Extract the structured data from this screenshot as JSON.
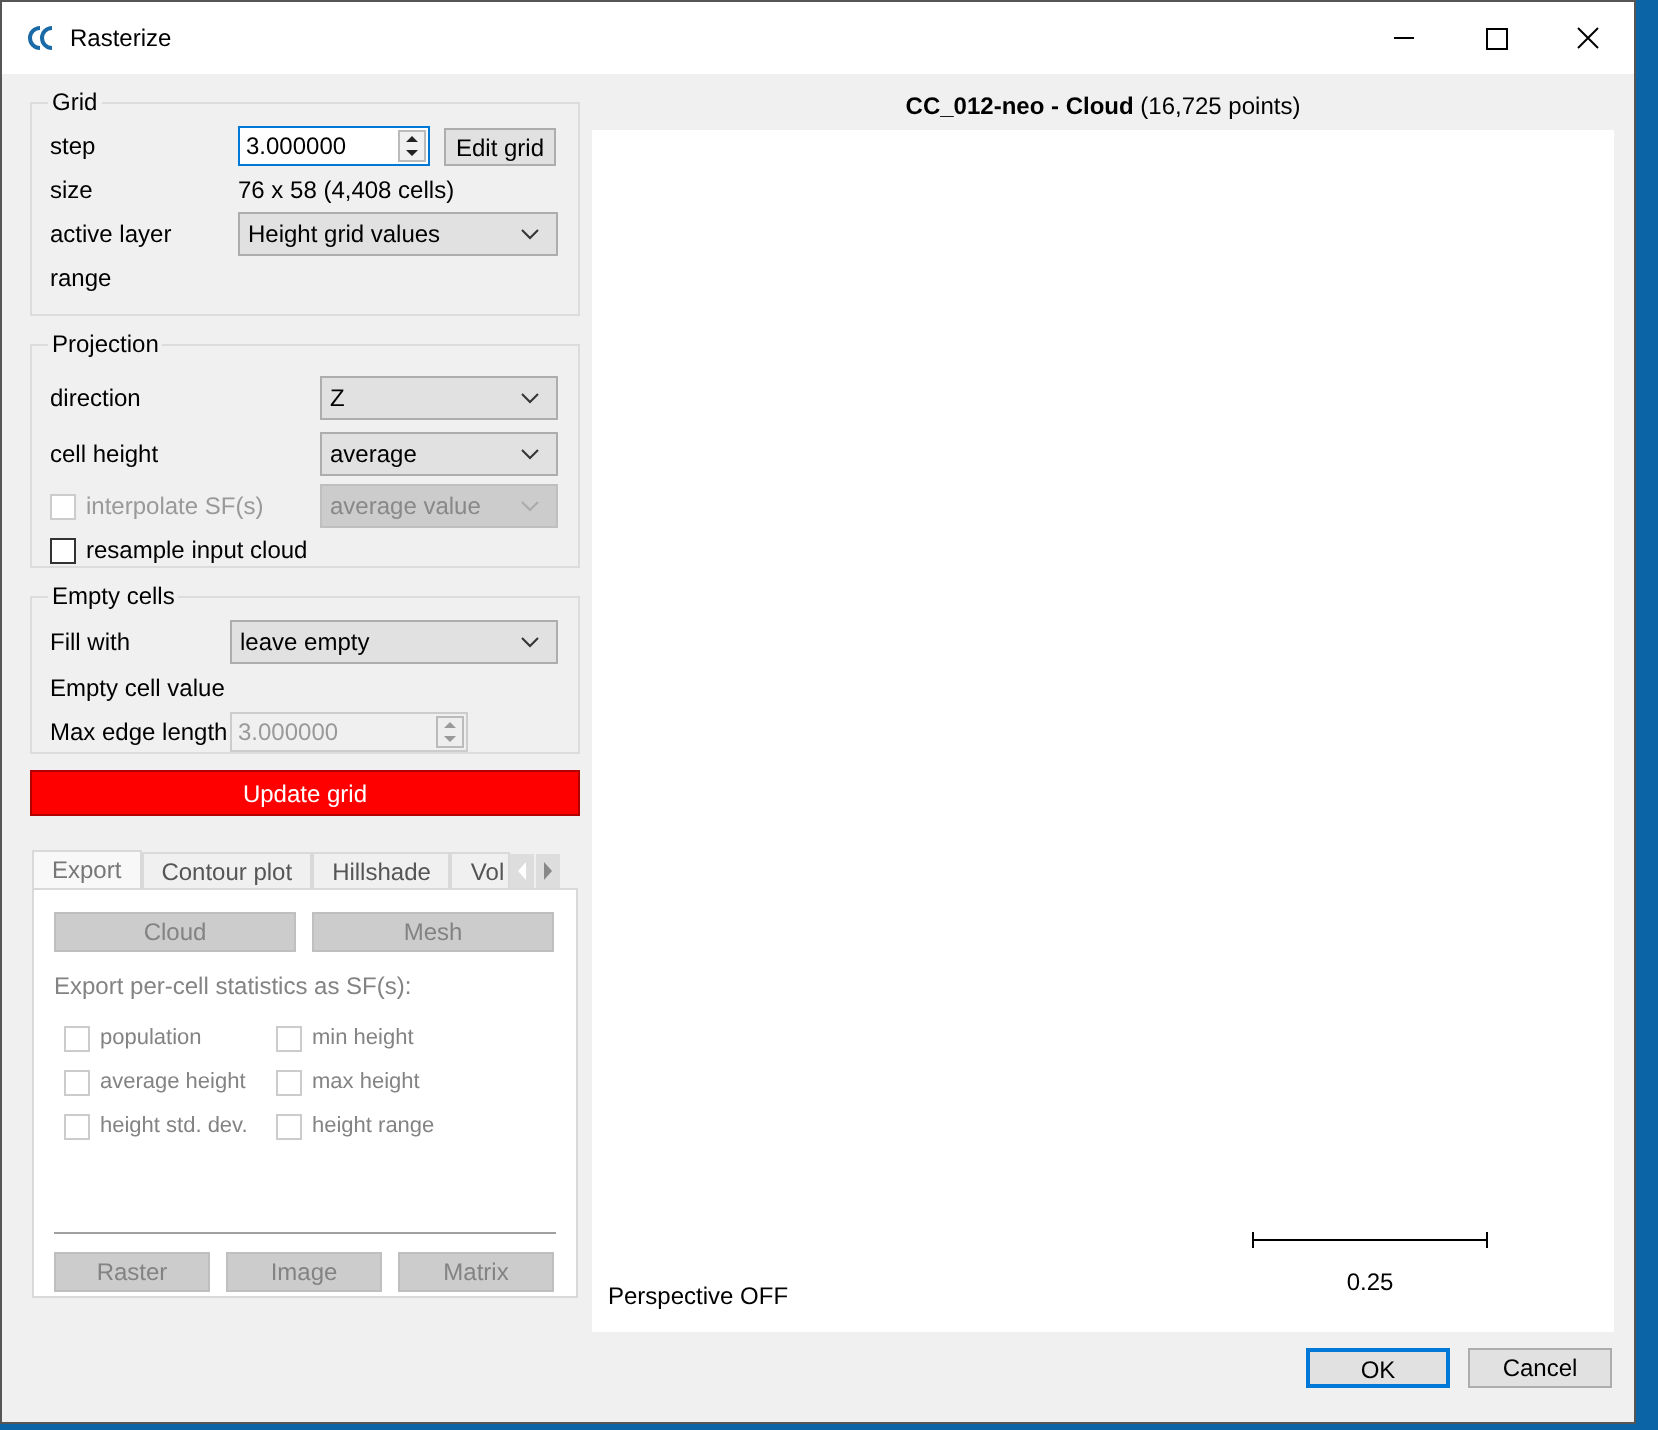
{
  "window": {
    "title": "Rasterize"
  },
  "grid": {
    "title": "Grid",
    "step": {
      "label": "step",
      "value": "3.000000"
    },
    "edit_button": "Edit grid",
    "size": {
      "label": "size",
      "value": "76 x 58 (4,408 cells)"
    },
    "active_layer": {
      "label": "active layer",
      "value": "Height grid values"
    },
    "range": {
      "label": "range"
    }
  },
  "projection": {
    "title": "Projection",
    "direction": {
      "label": "direction",
      "value": "Z"
    },
    "cell_height": {
      "label": "cell height",
      "value": "average"
    },
    "interpolate": {
      "label": "interpolate SF(s)",
      "checked": false,
      "disabled": true,
      "value": "average value"
    },
    "resample": {
      "label": "resample input cloud",
      "checked": false,
      "disabled": false
    }
  },
  "empty_cells": {
    "title": "Empty cells",
    "fill_with": {
      "label": "Fill with",
      "value": "leave empty"
    },
    "empty_cell_value": {
      "label": "Empty cell value"
    },
    "max_edge_length": {
      "label": "Max edge length",
      "value": "3.000000",
      "disabled": true
    }
  },
  "update_button": {
    "label": "Update grid"
  },
  "tabs": [
    {
      "label": "Export",
      "selected": true
    },
    {
      "label": "Contour plot",
      "selected": false
    },
    {
      "label": "Hillshade",
      "selected": false
    },
    {
      "label": "Vol",
      "selected": false
    }
  ],
  "export": {
    "buttons": [
      "Cloud",
      "Mesh"
    ],
    "stats_label": "Export per-cell statistics as SF(s):",
    "checkboxes": [
      {
        "label": "population",
        "checked": false,
        "disabled": true
      },
      {
        "label": "min height",
        "checked": false,
        "disabled": true
      },
      {
        "label": "average height",
        "checked": false,
        "disabled": true
      },
      {
        "label": "max height",
        "checked": false,
        "disabled": true
      },
      {
        "label": "height std. dev.",
        "checked": false,
        "disabled": true
      },
      {
        "label": "height range",
        "checked": false,
        "disabled": true
      }
    ],
    "bottom_buttons": [
      "Raster",
      "Image",
      "Matrix"
    ]
  },
  "viewer": {
    "title": "**CC_012-neo - Cloud** (16,725 points)",
    "scale_label": "0.25",
    "perspective": "Perspective OFF"
  },
  "dialog_buttons": [
    {
      "label": "OK",
      "default": true
    },
    {
      "label": "Cancel",
      "default": false
    }
  ]
}
